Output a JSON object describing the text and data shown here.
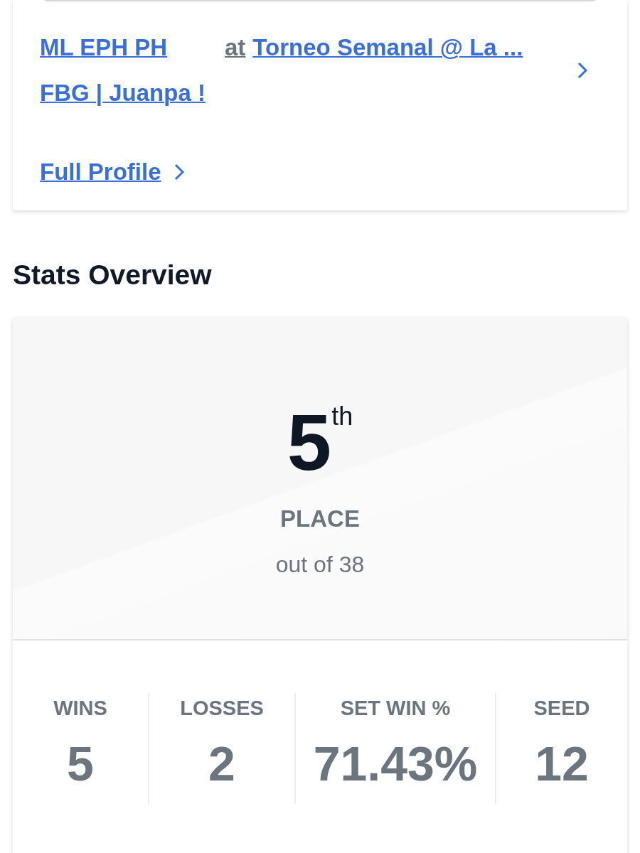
{
  "profile": {
    "players": [
      "ML EPH PH",
      "FBG | Juanpa !"
    ],
    "connector": "at",
    "event": "Torneo Semanal @ La ...",
    "full_profile": "Full Profile"
  },
  "stats_overview": {
    "title": "Stats Overview",
    "place": {
      "rank": "5",
      "suffix": "th",
      "label": "PLACE",
      "out_of": "out of 38"
    },
    "stats": [
      {
        "label": "WINS",
        "value": "5"
      },
      {
        "label": "LOSSES",
        "value": "2"
      },
      {
        "label": "SET WIN %",
        "value": "71.43%"
      },
      {
        "label": "SEED",
        "value": "12"
      }
    ]
  }
}
